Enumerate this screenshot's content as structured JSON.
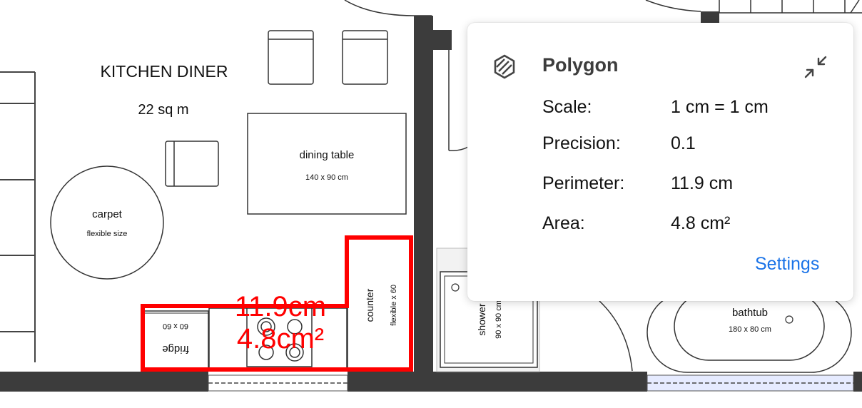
{
  "plan": {
    "room": {
      "name": "KITCHEN DINER",
      "area": "22 sq m"
    },
    "furniture": {
      "dining_table": {
        "name": "dining table",
        "size": "140 x 90 cm"
      },
      "carpet": {
        "name": "carpet",
        "size": "flexible size"
      },
      "counter": {
        "name": "counter",
        "size": "flexible x 60"
      },
      "fridge": {
        "name": "fridge",
        "size": "60 x 60"
      },
      "shower": {
        "name": "shower",
        "size": "90 x 90 cm"
      },
      "bathtub": {
        "name": "bathtub",
        "size": "180 x 80 cm"
      }
    },
    "measurement": {
      "perimeter_label": "11.9cm",
      "area_label": "4.8cm²",
      "color": "#ff0000"
    }
  },
  "panel": {
    "title": "Polygon",
    "icon": "polygon-hatched-icon",
    "collapse_icon": "collapse-arrows-icon",
    "rows": [
      {
        "label": "Scale:",
        "value": "1 cm = 1 cm"
      },
      {
        "label": "Precision:",
        "value": "0.1"
      },
      {
        "label": "Perimeter:",
        "value": "11.9 cm"
      },
      {
        "label": "Area:",
        "value": "4.8 cm²"
      }
    ],
    "settings_label": "Settings",
    "link_color": "#1a73e8"
  }
}
